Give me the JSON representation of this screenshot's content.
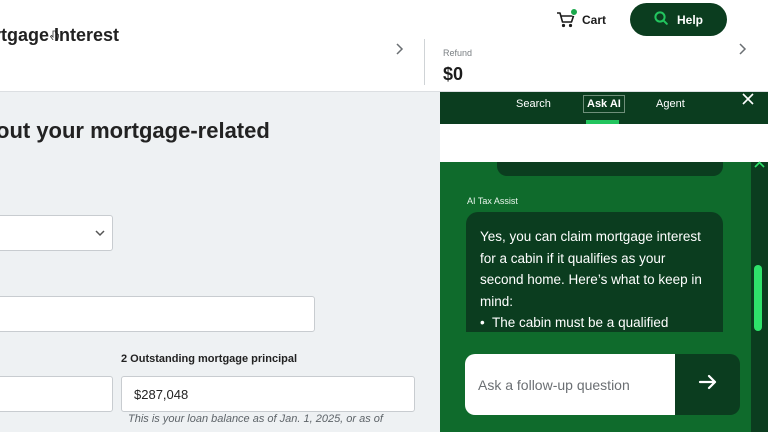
{
  "topbar": {
    "cart_label": "Cart",
    "help_label": "Help",
    "icons": {
      "cart": "cart-icon",
      "help": "search-icon",
      "cursor": "hand-pointer-icon"
    }
  },
  "header": {
    "section_title": "rtgage Interest",
    "refund_label": "Refund",
    "refund_value": "$0"
  },
  "main": {
    "heading": "out your mortgage-related",
    "principal_label": "2 Outstanding mortgage principal",
    "principal_value": "$287,048",
    "principal_help": "This is your loan balance as of Jan. 1, 2025, or as of"
  },
  "ai_panel": {
    "tabs": [
      {
        "label": "Search"
      },
      {
        "label": "Ask AI",
        "active": true
      },
      {
        "label": "Agent"
      }
    ],
    "close_icon": "close-icon",
    "sender": "AI Tax Assist",
    "message": {
      "text": "Yes, you can claim mortgage interest for a cabin if it qualifies as your second home. Here’s what to keep in mind:",
      "bullets": [
        "The cabin must be a qualified"
      ]
    },
    "followup_placeholder": "Ask a follow-up question",
    "send_icon": "arrow-right-icon"
  },
  "colors": {
    "brand_dark": "#0b3d1f",
    "panel_green": "#0f6b2c",
    "accent_green": "#22c55e"
  }
}
